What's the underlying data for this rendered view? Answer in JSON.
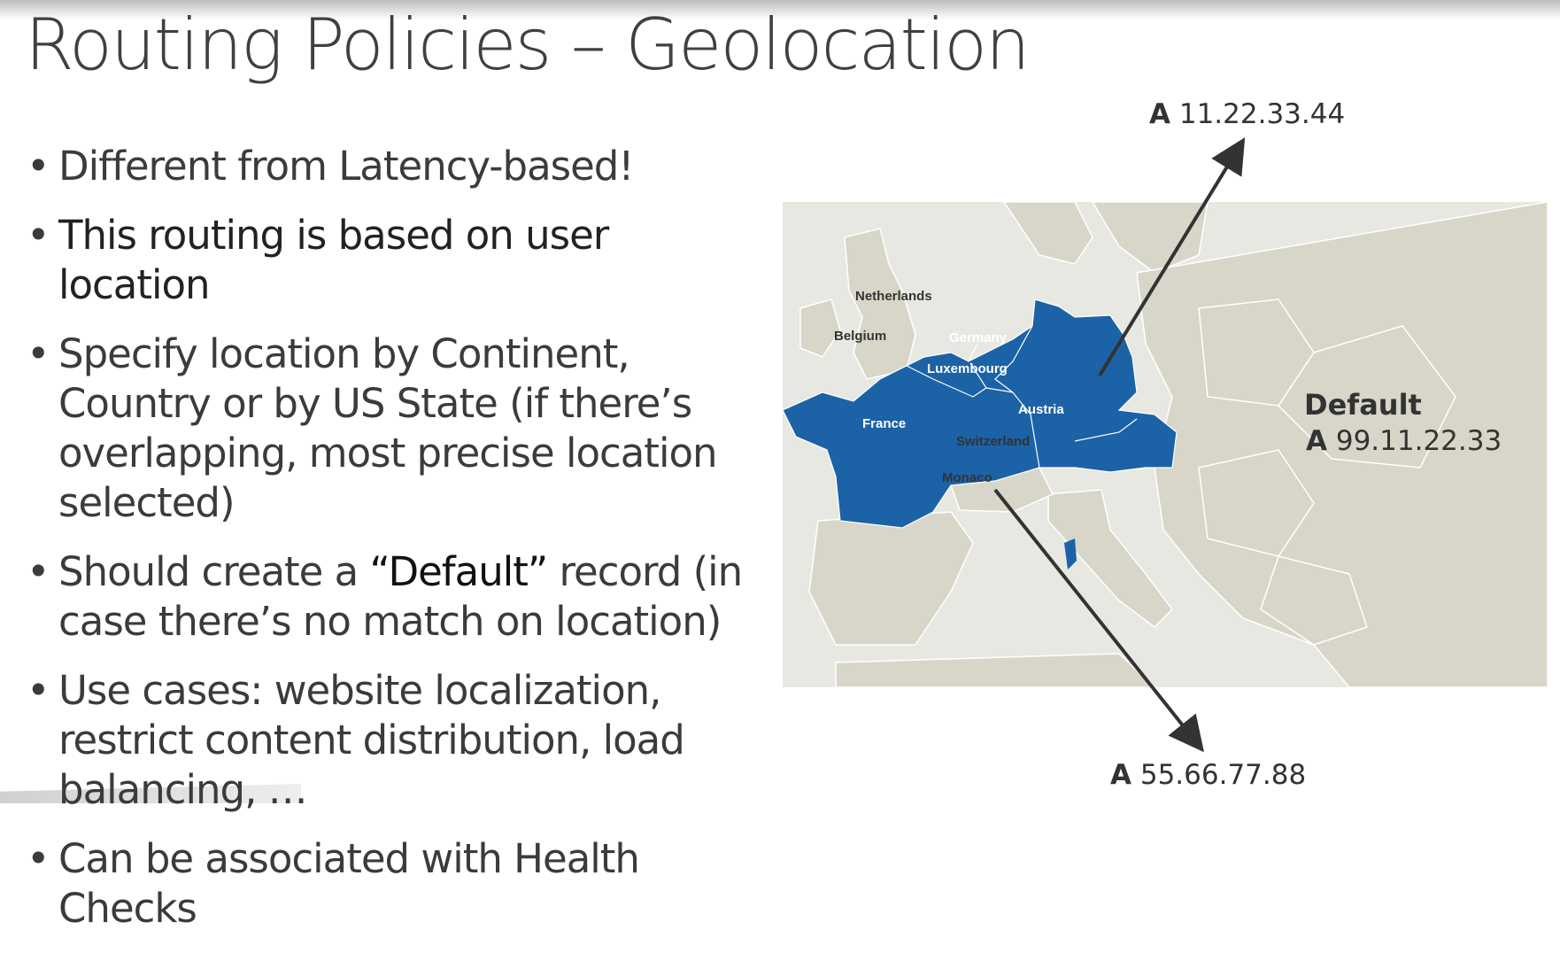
{
  "slide": {
    "title": "Routing Policies – Geolocation",
    "bullets": [
      {
        "text": "Different from Latency-based!"
      },
      {
        "text": "This routing is based on user location"
      },
      {
        "text": "Specify location by Continent, Country or by US State (if there’s overlapping, most precise location selected)"
      },
      {
        "pre": "Should create a ",
        "emph": "“Default”",
        "post": " record (in case there’s no match on location)"
      },
      {
        "text": "Use cases: website localization, restrict content distribution, load balancing, …"
      },
      {
        "text": "Can be associated with Health Checks"
      }
    ]
  },
  "map": {
    "highlight_color": "#1c62a6",
    "land_color": "#d8d6c8",
    "sea_color": "#e8e8e3",
    "countries": {
      "netherlands": "Netherlands",
      "belgium": "Belgium",
      "germany": "Germany",
      "luxembourg": "Luxembourg",
      "austria": "Austria",
      "france": "France",
      "switzerland": "Switzerland",
      "monaco": "Monaco"
    }
  },
  "records": {
    "top": {
      "type": "A",
      "ip": "11.22.33.44"
    },
    "bottom": {
      "type": "A",
      "ip": "55.66.77.88"
    },
    "default": {
      "label": "Default",
      "type": "A",
      "ip": "99.11.22.33"
    }
  }
}
